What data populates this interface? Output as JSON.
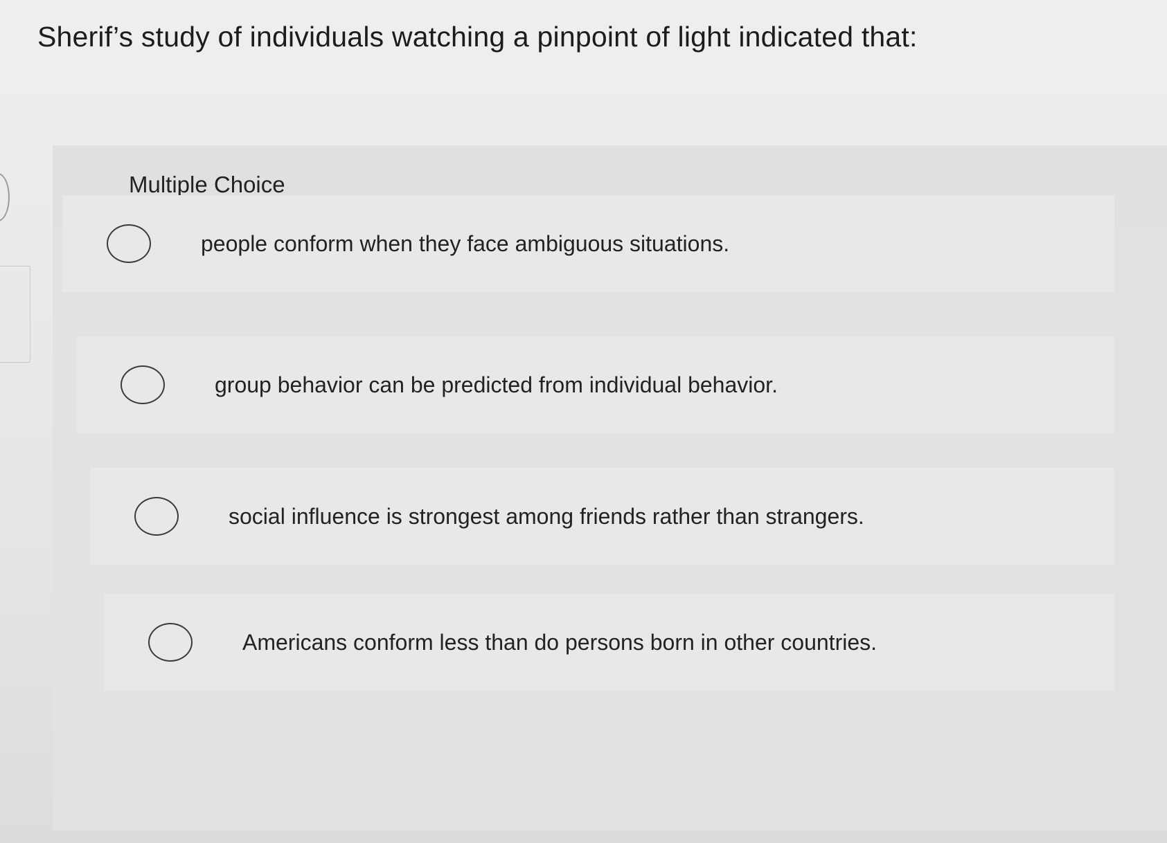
{
  "question": {
    "text": "Sherif’s study of individuals watching a pinpoint of light indicated that:"
  },
  "section": {
    "label": "Multiple Choice"
  },
  "options": [
    {
      "label": "people conform when they face ambiguous situations.",
      "selected": false
    },
    {
      "label": "group behavior can be predicted from individual behavior.",
      "selected": false
    },
    {
      "label": "social influence is strongest among friends rather than strangers.",
      "selected": false
    },
    {
      "label": "Americans conform less than do persons born in other countries.",
      "selected": false
    }
  ],
  "colors": {
    "background": "#efefed",
    "panel": "#e3e3e2",
    "text": "#1f1f1f",
    "radio_border": "#3a3a3a"
  }
}
